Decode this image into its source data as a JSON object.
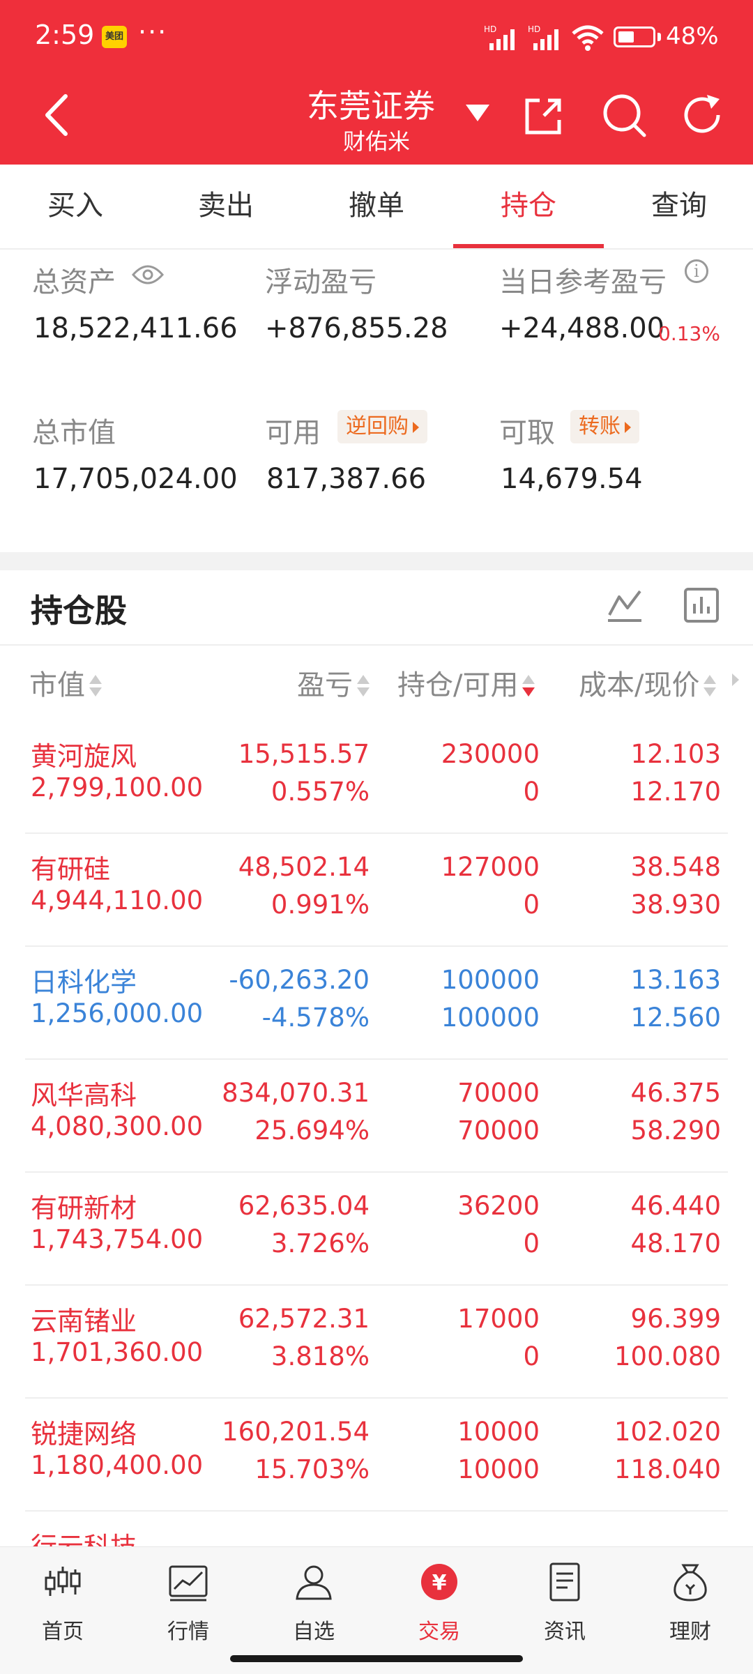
{
  "status": {
    "time": "2:59",
    "app_badge": "美团",
    "more": "···",
    "signal_label": "HD",
    "battery": "48%",
    "battery_level": 0.48
  },
  "header": {
    "title": "东莞证券",
    "subtitle": "财佑米"
  },
  "tabs": [
    {
      "label": "买入"
    },
    {
      "label": "卖出"
    },
    {
      "label": "撤单"
    },
    {
      "label": "持仓"
    },
    {
      "label": "查询"
    }
  ],
  "active_tab": "持仓",
  "summary": {
    "total_assets_label": "总资产",
    "total_assets": "18,522,411.66",
    "floating_pl_label": "浮动盈亏",
    "floating_pl": "+876,855.28",
    "daily_pl_label": "当日参考盈亏",
    "daily_pl": "+24,488.00",
    "daily_pl_pct": "0.13%",
    "market_value_label": "总市值",
    "market_value": "17,705,024.00",
    "available_label": "可用",
    "available": "817,387.66",
    "repo_button": "逆回购",
    "withdrawable_label": "可取",
    "withdrawable": "14,679.54",
    "transfer_button": "转账"
  },
  "holdings": {
    "title": "持仓股",
    "columns": {
      "market_value": "市值",
      "pl": "盈亏",
      "position": "持仓/可用",
      "cost_price": "成本/现价"
    },
    "rows": [
      {
        "name": "黄河旋风",
        "market_value": "2,799,100.00",
        "pl": "15,515.57",
        "pl_pct": "0.557%",
        "position": "230000",
        "available": "0",
        "cost": "12.103",
        "price": "12.170",
        "color": "#e8313d"
      },
      {
        "name": "有研硅",
        "market_value": "4,944,110.00",
        "pl": "48,502.14",
        "pl_pct": "0.991%",
        "position": "127000",
        "available": "0",
        "cost": "38.548",
        "price": "38.930",
        "color": "#e8313d"
      },
      {
        "name": "日科化学",
        "market_value": "1,256,000.00",
        "pl": "-60,263.20",
        "pl_pct": "-4.578%",
        "position": "100000",
        "available": "100000",
        "cost": "13.163",
        "price": "12.560",
        "color": "#3a83d8"
      },
      {
        "name": "风华高科",
        "market_value": "4,080,300.00",
        "pl": "834,070.31",
        "pl_pct": "25.694%",
        "position": "70000",
        "available": "70000",
        "cost": "46.375",
        "price": "58.290",
        "color": "#e8313d"
      },
      {
        "name": "有研新材",
        "market_value": "1,743,754.00",
        "pl": "62,635.04",
        "pl_pct": "3.726%",
        "position": "36200",
        "available": "0",
        "cost": "46.440",
        "price": "48.170",
        "color": "#e8313d"
      },
      {
        "name": "云南锗业",
        "market_value": "1,701,360.00",
        "pl": "62,572.31",
        "pl_pct": "3.818%",
        "position": "17000",
        "available": "0",
        "cost": "96.399",
        "price": "100.080",
        "color": "#e8313d"
      },
      {
        "name": "锐捷网络",
        "market_value": "1,180,400.00",
        "pl": "160,201.54",
        "pl_pct": "15.703%",
        "position": "10000",
        "available": "10000",
        "cost": "102.020",
        "price": "118.040",
        "color": "#e8313d"
      },
      {
        "name": "行云科技",
        "market_value": "",
        "pl": "",
        "pl_pct": "",
        "position": "",
        "available": "",
        "cost": "",
        "price": "",
        "color": "#e8313d"
      }
    ]
  },
  "bottom_nav": [
    {
      "label": "首页",
      "icon": "candlestick-icon"
    },
    {
      "label": "行情",
      "icon": "chart-icon"
    },
    {
      "label": "自选",
      "icon": "person-icon"
    },
    {
      "label": "交易",
      "icon": "yuan-icon"
    },
    {
      "label": "资讯",
      "icon": "document-icon"
    },
    {
      "label": "理财",
      "icon": "moneybag-icon"
    }
  ],
  "active_nav": "交易",
  "colors": {
    "brand_red": "#ef2f3b",
    "gain": "#e8313d",
    "loss": "#3a83d8",
    "accent_orange": "#ec6a1f"
  }
}
